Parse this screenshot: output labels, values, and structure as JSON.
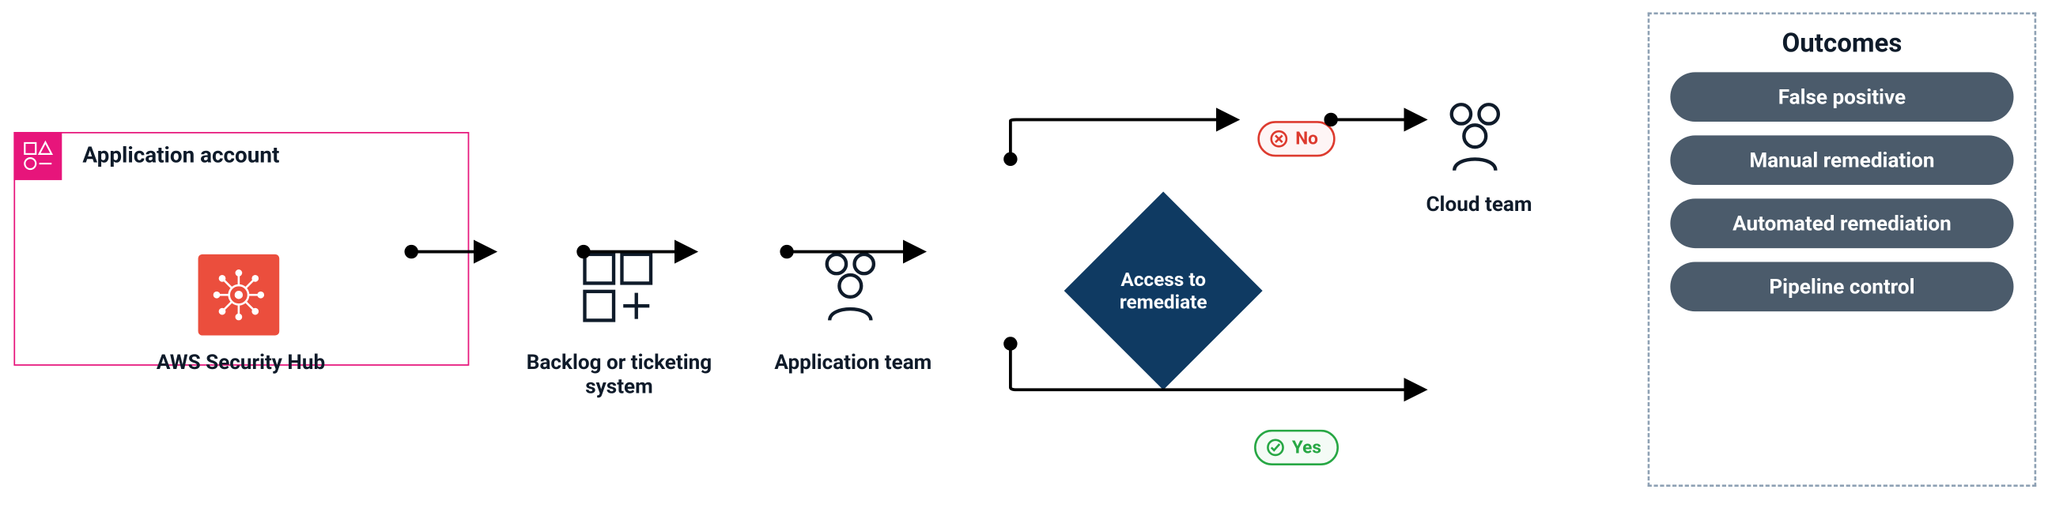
{
  "account": {
    "title": "Application account"
  },
  "sechub": {
    "label": "AWS Security Hub"
  },
  "backlog": {
    "label": "Backlog or ticketing system"
  },
  "app_team": {
    "label": "Application team"
  },
  "cloud_team": {
    "label": "Cloud team"
  },
  "decision": {
    "label": "Access to remediate"
  },
  "tags": {
    "no": "No",
    "yes": "Yes"
  },
  "outcomes": {
    "title": "Outcomes",
    "items": {
      "0": "False positive",
      "1": "Manual remediation",
      "2": "Automated remediation",
      "3": "Pipeline control"
    }
  }
}
